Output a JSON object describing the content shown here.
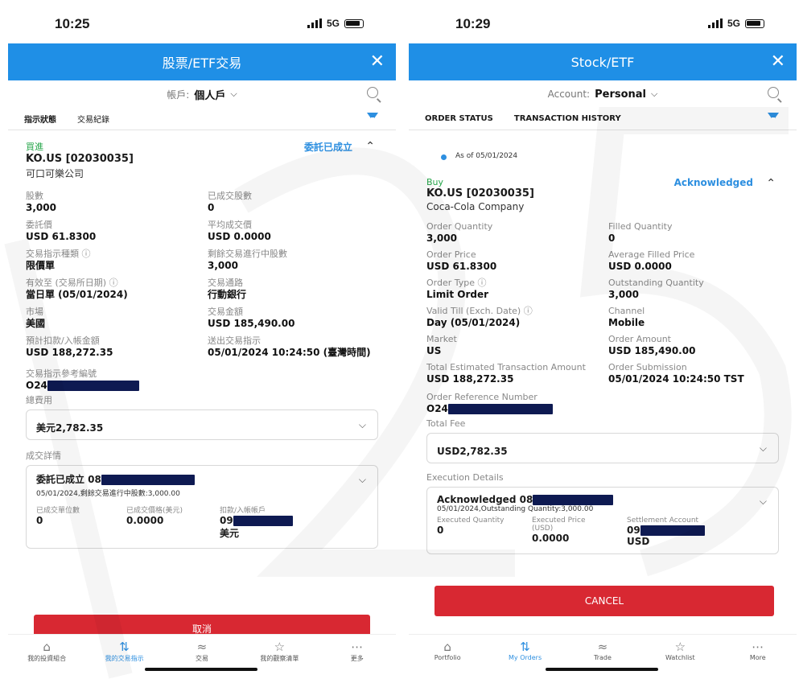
{
  "left": {
    "status_time": "10:25",
    "network": "5G",
    "title": "股票/ETF交易",
    "account_label": "帳戶:",
    "account_value": "個人戶",
    "tabs": [
      "指示狀態",
      "交易紀錄"
    ],
    "order": {
      "side": "買進",
      "code": "KO.US [02030035]",
      "company": "可口可樂公司",
      "status": "委託已成立"
    },
    "fields": [
      {
        "label": "股數",
        "value": "3,000"
      },
      {
        "label": "已成交股數",
        "value": "0"
      },
      {
        "label": "委託價",
        "value": "USD 61.8300"
      },
      {
        "label": "平均成交價",
        "value": "USD 0.0000"
      },
      {
        "label": "交易指示種類",
        "value": "限價單"
      },
      {
        "label": "剩餘交易進行中股數",
        "value": "3,000"
      },
      {
        "label": "有效至 (交易所日期)",
        "value": "當日單 (05/01/2024)"
      },
      {
        "label": "交易通路",
        "value": "行動銀行"
      },
      {
        "label": "市場",
        "value": "美國"
      },
      {
        "label": "交易金額",
        "value": "USD 185,490.00"
      },
      {
        "label": "預計扣款/入帳金額",
        "value": "USD 188,272.35"
      },
      {
        "label": "送出交易指示",
        "value": "05/01/2024 10:24:50 (臺灣時間)"
      }
    ],
    "ref_label": "交易指示參考編號",
    "ref_value": "O24",
    "fee_label": "總費用",
    "fee_value": "美元2,782.35",
    "exec_label": "成交詳情",
    "exec_title": "委託已成立 08",
    "exec_sub": "05/01/2024,剩餘交易進行中股數:3,000.00",
    "exec_cols": [
      {
        "label": "已成交單位數",
        "value": "0"
      },
      {
        "label": "已成交價格(美元)",
        "value": "0.0000"
      },
      {
        "label": "扣款/入帳帳戶",
        "value": "09",
        "extra": "美元"
      }
    ],
    "cancel_label": "取消",
    "nav": [
      {
        "label": "我的投資組合",
        "icon": "portfolio-icon",
        "glyph": "⌂"
      },
      {
        "label": "我的交易指示",
        "icon": "orders-icon",
        "glyph": "⇅"
      },
      {
        "label": "交易",
        "icon": "trade-icon",
        "glyph": "≈"
      },
      {
        "label": "我的觀察清單",
        "icon": "watchlist-icon",
        "glyph": "☆"
      },
      {
        "label": "更多",
        "icon": "more-icon",
        "glyph": "⋯"
      }
    ]
  },
  "right": {
    "status_time": "10:29",
    "network": "5G",
    "title": "Stock/ETF",
    "account_label": "Account:",
    "account_value": "Personal",
    "tabs": [
      "ORDER STATUS",
      "TRANSACTION HISTORY"
    ],
    "as_of": "As of 05/01/2024",
    "order": {
      "side": "Buy",
      "code": "KO.US [02030035]",
      "company": "Coca-Cola Company",
      "status": "Acknowledged"
    },
    "fields": [
      {
        "label": "Order Quantity",
        "value": "3,000"
      },
      {
        "label": "Filled Quantity",
        "value": "0"
      },
      {
        "label": "Order Price",
        "value": "USD 61.8300"
      },
      {
        "label": "Average Filled Price",
        "value": "USD 0.0000"
      },
      {
        "label": "Order Type",
        "value": "Limit Order"
      },
      {
        "label": "Outstanding Quantity",
        "value": "3,000"
      },
      {
        "label": "Valid Till (Exch. Date)",
        "value": "Day (05/01/2024)"
      },
      {
        "label": "Channel",
        "value": "Mobile"
      },
      {
        "label": "Market",
        "value": "US"
      },
      {
        "label": "Order Amount",
        "value": "USD 185,490.00"
      },
      {
        "label": "Total Estimated Transaction Amount",
        "value": "USD 188,272.35"
      },
      {
        "label": "Order Submission",
        "value": "05/01/2024 10:24:50 TST"
      }
    ],
    "ref_label": "Order Reference Number",
    "ref_value": "O24",
    "fee_label": "Total Fee",
    "fee_value": "USD2,782.35",
    "exec_label": "Execution Details",
    "exec_title": "Acknowledged 08",
    "exec_sub": "05/01/2024,Outstanding Quantity:3,000.00",
    "exec_cols": [
      {
        "label": "Executed Quantity",
        "value": "0"
      },
      {
        "label": "Executed Price (USD)",
        "value": "0.0000"
      },
      {
        "label": "Settlement Account",
        "value": "09",
        "extra": "USD"
      }
    ],
    "cancel_label": "CANCEL",
    "nav": [
      {
        "label": "Portfolio",
        "icon": "portfolio-icon",
        "glyph": "⌂"
      },
      {
        "label": "My Orders",
        "icon": "orders-icon",
        "glyph": "⇅"
      },
      {
        "label": "Trade",
        "icon": "trade-icon",
        "glyph": "≈"
      },
      {
        "label": "Watchlist",
        "icon": "watchlist-icon",
        "glyph": "☆"
      },
      {
        "label": "More",
        "icon": "more-icon",
        "glyph": "⋯"
      }
    ]
  }
}
